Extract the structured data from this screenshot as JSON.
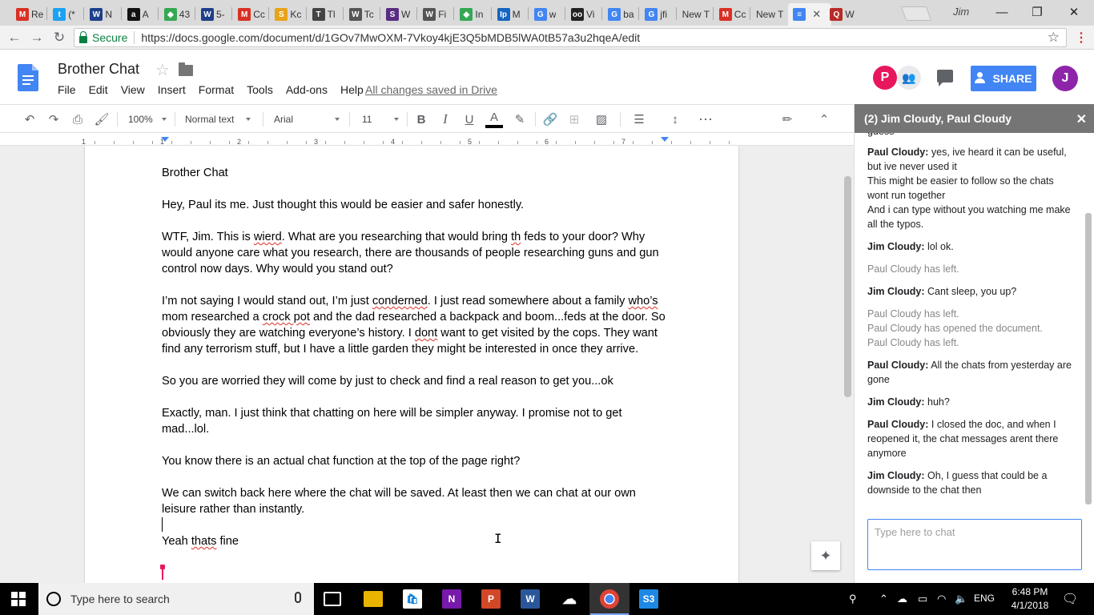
{
  "browser": {
    "tabs": [
      {
        "title": "Re",
        "icon": "gmail-icon",
        "color": "#d93025",
        "glyph": "M"
      },
      {
        "title": "(*",
        "icon": "twitter-icon",
        "color": "#1da1f2",
        "glyph": "t"
      },
      {
        "title": "N",
        "icon": "weather-icon",
        "color": "#1e3f8a",
        "glyph": "W"
      },
      {
        "title": "A",
        "icon": "amazon-icon",
        "color": "#111111",
        "glyph": "a"
      },
      {
        "title": "43",
        "icon": "maps-icon",
        "color": "#34a853",
        "glyph": "◆"
      },
      {
        "title": "5-",
        "icon": "weather-icon",
        "color": "#1e3f8a",
        "glyph": "W"
      },
      {
        "title": "Cc",
        "icon": "gmail-icon",
        "color": "#d93025",
        "glyph": "M"
      },
      {
        "title": "Kc",
        "icon": "sun-icon",
        "color": "#e8a317",
        "glyph": "S"
      },
      {
        "title": "Tl",
        "icon": "news-icon",
        "color": "#444444",
        "glyph": "T"
      },
      {
        "title": "Tc",
        "icon": "wikipedia-icon",
        "color": "#555555",
        "glyph": "W"
      },
      {
        "title": "W",
        "icon": "tab-icon",
        "color": "#5a2d82",
        "glyph": "S"
      },
      {
        "title": "Fi",
        "icon": "wikipedia-icon",
        "color": "#555555",
        "glyph": "W"
      },
      {
        "title": "In",
        "icon": "maps-icon",
        "color": "#34a853",
        "glyph": "◆"
      },
      {
        "title": "M",
        "icon": "ip-icon",
        "color": "#1565c0",
        "glyph": "Ip"
      },
      {
        "title": "w",
        "icon": "google-icon",
        "color": "#4285f4",
        "glyph": "G"
      },
      {
        "title": "Vi",
        "icon": "tripadvisor-icon",
        "color": "#222222",
        "glyph": "oo"
      },
      {
        "title": "ba",
        "icon": "google-icon",
        "color": "#4285f4",
        "glyph": "G"
      },
      {
        "title": "jfi",
        "icon": "google-icon",
        "color": "#4285f4",
        "glyph": "G"
      },
      {
        "title": "New T",
        "icon": "",
        "color": "",
        "glyph": ""
      },
      {
        "title": "Cc",
        "icon": "gmail-icon",
        "color": "#d93025",
        "glyph": "M"
      },
      {
        "title": "New T",
        "icon": "",
        "color": "",
        "glyph": ""
      },
      {
        "title": "",
        "icon": "docs-icon",
        "color": "#4285f4",
        "glyph": "≡",
        "active": true
      },
      {
        "title": "W",
        "icon": "quora-icon",
        "color": "#b92b27",
        "glyph": "Q"
      }
    ],
    "profile_name": "Jim",
    "secure_label": "Secure",
    "url": "https://docs.google.com/document/d/1GOv7MwOXM-7Vkoy4kjE3Q5bMDB5lWA0tB57a3u2hqeA/edit",
    "controls": {
      "minimize": "—",
      "restore": "❐",
      "close": "✕"
    }
  },
  "docs": {
    "title": "Brother Chat",
    "menu": [
      "File",
      "Edit",
      "View",
      "Insert",
      "Format",
      "Tools",
      "Add-ons",
      "Help"
    ],
    "save_status": "All changes saved in Drive",
    "share_label": "SHARE",
    "avatars": {
      "p": "P",
      "j": "J"
    },
    "colors": {
      "accent": "#4285f4",
      "avatar_p": "#e8175d",
      "avatar_j": "#8e24aa"
    }
  },
  "toolbar": {
    "zoom": "100%",
    "style": "Normal text",
    "font": "Arial",
    "size": "11",
    "bold": "B",
    "italic": "I",
    "underline": "U",
    "text_color": "A",
    "more": "⋯"
  },
  "ruler": {
    "numbers": [
      "1",
      "1",
      "2",
      "3",
      "4",
      "5",
      "6",
      "7"
    ]
  },
  "document": {
    "heading": "Brother Chat",
    "p1": "Hey, Paul its me. Just thought this would be easier and safer honestly.",
    "p2a": "WTF, Jim. This is ",
    "p2b": "wierd",
    "p2c": ". What are you researching that would bring ",
    "p2d": "th",
    "p2e": " feds to your door? Why would anyone care what you research, there are thousands of people researching guns and gun control now days. Why would you stand out?",
    "p3a": "I’m not saying I would stand out, I’m just ",
    "p3b": "conderned",
    "p3c": ". I just read somewhere about a family ",
    "p3d": "who’s",
    "p3e": " mom researched a ",
    "p3f": "crock pot",
    "p3g": " and the dad researched a backpack and boom...feds at the door. So obviously they are watching everyone’s history. I ",
    "p3h": "dont",
    "p3i": " want to get visited by the cops. They want find any terrorism stuff, but I have a little garden they might be interested in once they arrive.",
    "p4": "So you are worried they will come by just to check and find a real reason to get you...ok",
    "p5": "Exactly, man. I just think that chatting on here will be simpler anyway. I promise not to get mad...lol.",
    "p6": "You know there is an actual chat function at the top of the page right?",
    "p7": "We can switch back here where the chat will be saved. At least then we can chat at our own leisure rather than instantly.",
    "p8a": "Yeah ",
    "p8b": "thats",
    "p8c": " fine"
  },
  "chat": {
    "title": "(2) Jim Cloudy, Paul Cloudy",
    "close": "✕",
    "top_fragment": "guess",
    "messages": [
      {
        "who": "Paul Cloudy:",
        "text": "yes, ive heard it can be useful, but ive never used it",
        "more": [
          "This might be easier to follow so the chats wont run together",
          "And i can type without you watching me make all the typos."
        ]
      },
      {
        "who": "Jim Cloudy:",
        "text": "lol ok."
      },
      {
        "sys": [
          "Paul Cloudy has left."
        ]
      },
      {
        "who": "Jim Cloudy:",
        "text": "Cant sleep, you up?"
      },
      {
        "sys": [
          "Paul Cloudy has left.",
          "Paul Cloudy has opened the document.",
          "Paul Cloudy has left."
        ]
      },
      {
        "who": "Paul Cloudy:",
        "text": "All the chats from yesterday are gone"
      },
      {
        "who": "Jim Cloudy:",
        "text": "huh?"
      },
      {
        "who": "Paul Cloudy:",
        "text": "I closed the doc, and when I reopened it, the chat messages arent there anymore"
      },
      {
        "who": "Jim Cloudy:",
        "text": "Oh, I guess that could be a downside to the chat then"
      }
    ],
    "input_placeholder": "Type here to chat"
  },
  "taskbar": {
    "search_placeholder": "Type here to search",
    "language": "ENG",
    "time": "6:48 PM",
    "date": "4/1/2018"
  }
}
